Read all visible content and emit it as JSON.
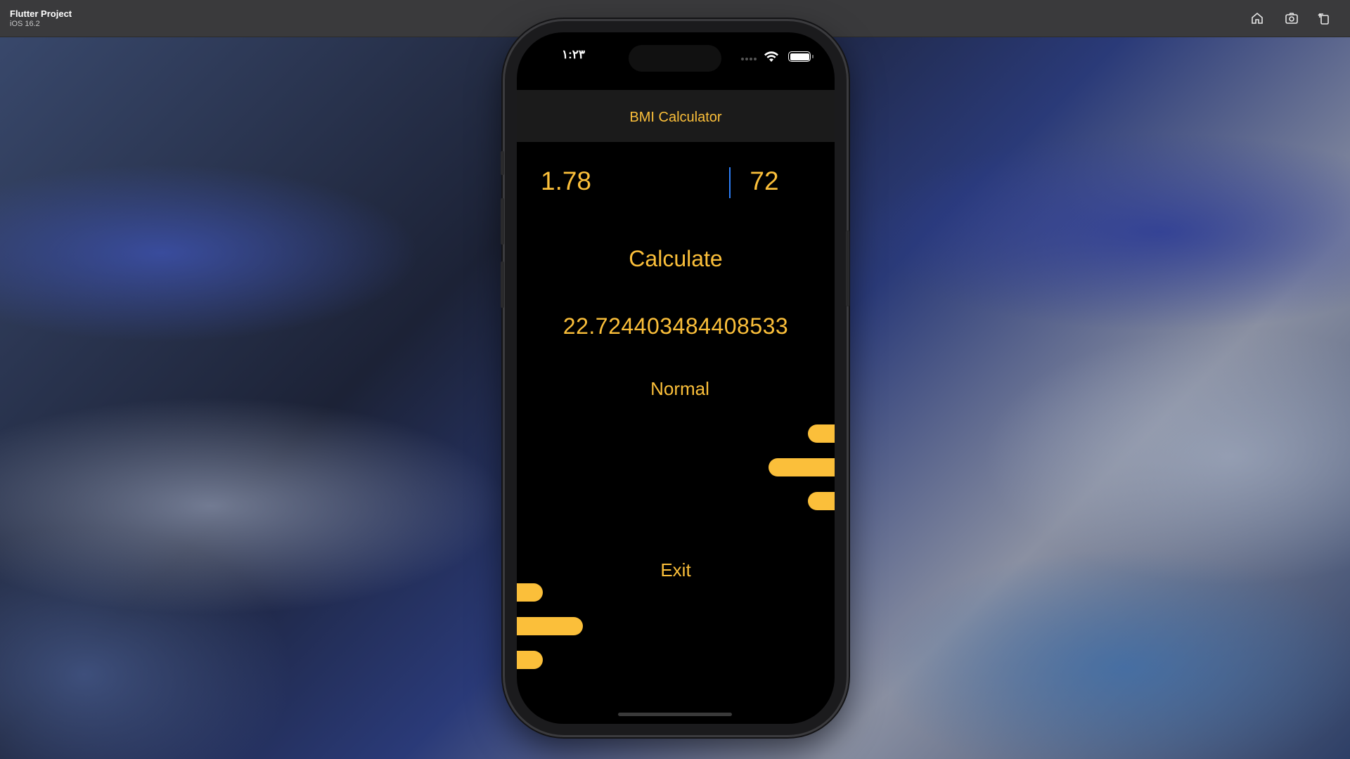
{
  "window": {
    "title": "Flutter Project",
    "subtitle": "iOS 16.2",
    "toolbar_icons": [
      "home-icon",
      "screenshot-icon",
      "rotate-icon"
    ]
  },
  "status_bar": {
    "time": "١:٢٣"
  },
  "app": {
    "title": "BMI Calculator",
    "height_value": "1.78",
    "weight_value": "72",
    "calculate_label": "Calculate",
    "bmi_result": "22.724403484408533",
    "category": "Normal",
    "exit_label": "Exit",
    "accent_color": "#fbbf3a"
  }
}
